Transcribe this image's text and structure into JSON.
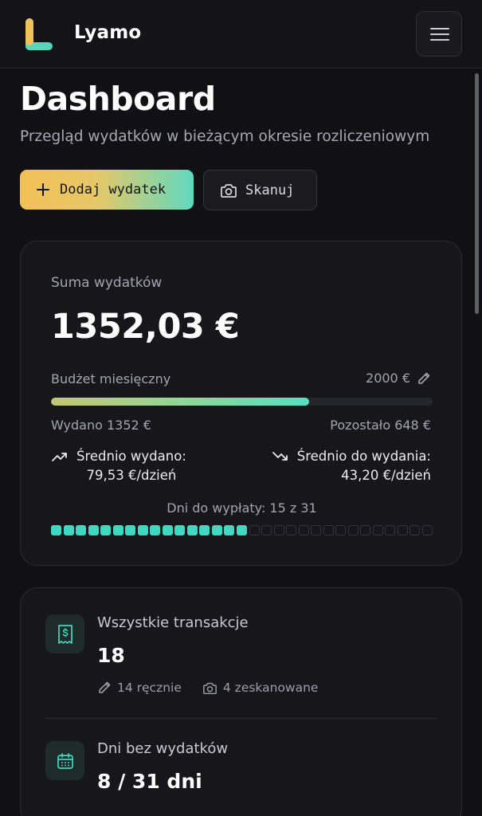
{
  "header": {
    "brand": "Lyamo",
    "logo_icon": "lyamo-logo",
    "menu_icon": "hamburger-menu-icon"
  },
  "page": {
    "title": "Dashboard",
    "subtitle": "Przegląd wydatków w bieżącym okresie rozliczeniowym"
  },
  "actions": {
    "add_label": "Dodaj wydatek",
    "scan_label": "Skanuj"
  },
  "summary": {
    "total_label": "Suma wydatków",
    "total_value": "1352,03 €",
    "budget_label": "Budżet miesięczny",
    "budget_value": "2000 €",
    "budget_spent_fraction": 0.676,
    "spent_text": "Wydano 1352 €",
    "remaining_text": "Pozostało 648 €",
    "avg_spent_label": "Średnio wydano:",
    "avg_spent_value": "79,53 €/dzień",
    "avg_left_label": "Średnio do wydania:",
    "avg_left_value": "43,20 €/dzień",
    "payday_text": "Dni do wypłaty: 15 z 31",
    "payday_elapsed": 16,
    "payday_total": 31
  },
  "stats": {
    "transactions_label": "Wszystkie transakcje",
    "transactions_value": "18",
    "manual_text": "14 ręcznie",
    "scanned_text": "4 zeskanowane",
    "no_spend_label": "Dni bez wydatków",
    "no_spend_value": "8 / 31 dni"
  },
  "colors": {
    "accent_teal": "#3fd8c0",
    "accent_yellow": "#f3c055",
    "background": "#111115"
  }
}
